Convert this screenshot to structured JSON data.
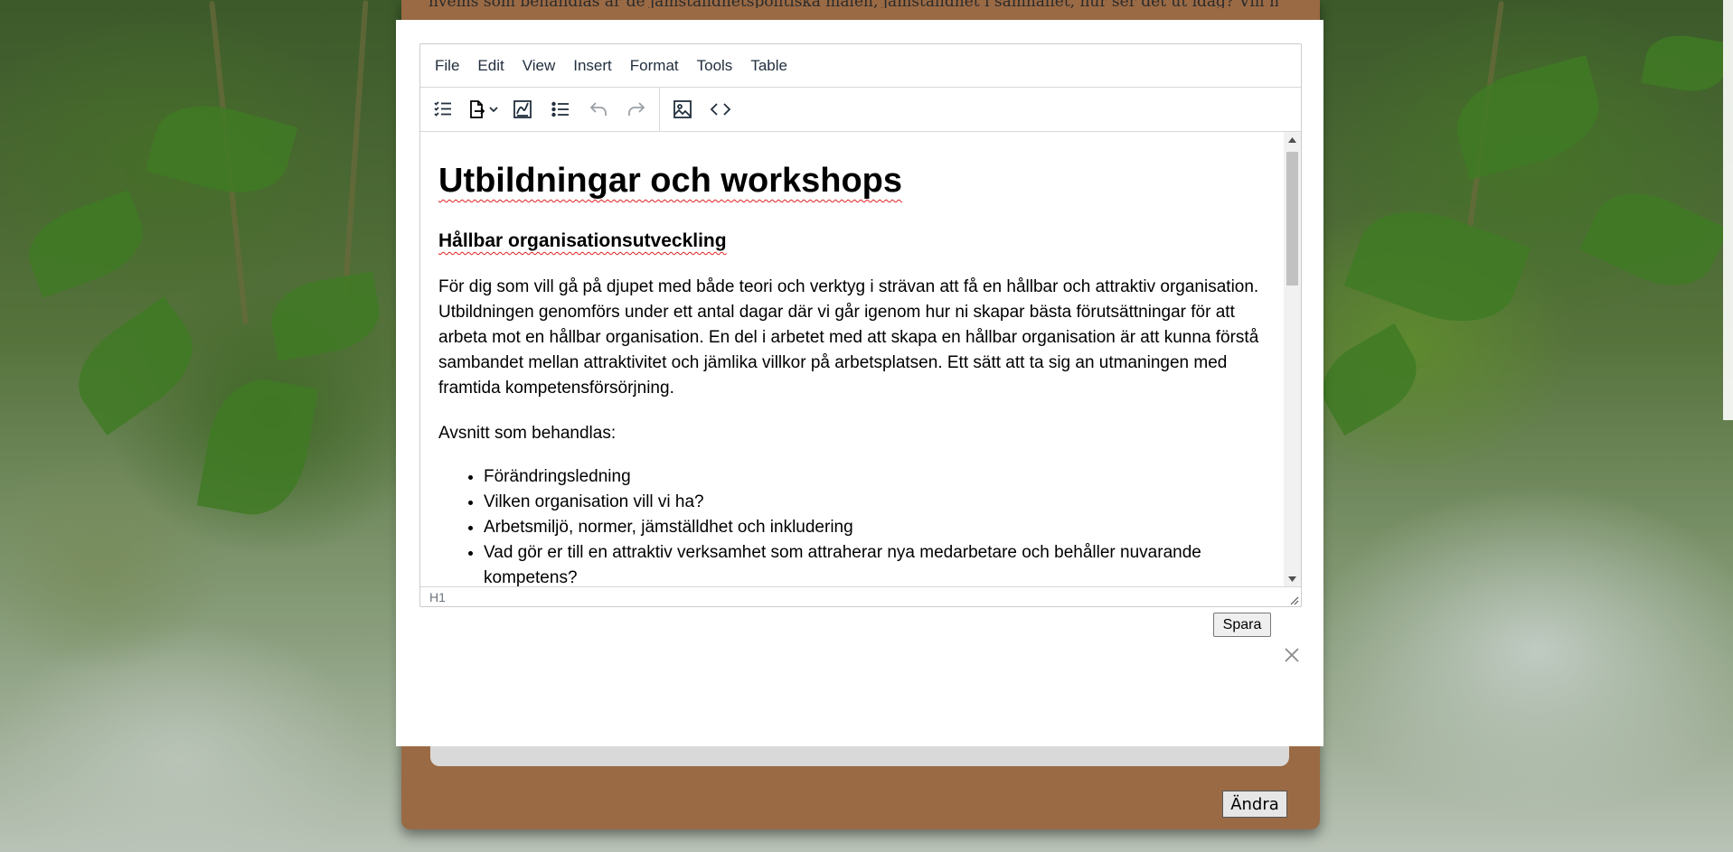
{
  "background": {
    "description": ""
  },
  "card": {
    "top_text": "hvems som behandlas är de jämställdhetspolitiska målen, jämställdhet i samhället, hur ser det ut idag? Vill ni veta mer om det för att få ett förtydligande i jämställdhet handlar om? Utbildningen går igenom",
    "andra_label": "Ändra"
  },
  "editor": {
    "menubar": [
      "File",
      "Edit",
      "View",
      "Insert",
      "Format",
      "Tools",
      "Table"
    ],
    "toolbar": {
      "icons": [
        "checklist-icon",
        "export-icon",
        "chevron-down-icon",
        "signature-icon",
        "bullet-list-icon",
        "undo-icon",
        "redo-icon",
        "image-icon",
        "code-icon"
      ]
    },
    "content": {
      "h1": "Utbildningar och workshops",
      "h2": "Hållbar organisationsutveckling",
      "paragraph1": "För dig som vill gå på djupet med både teori och verktyg i strävan att få en hållbar och attraktiv organisation. Utbildningen genomförs under ett antal dagar där vi går igenom hur ni skapar bästa förutsättningar för att arbeta mot en hållbar organisation. En del i arbetet med att skapa en hållbar organisation är att kunna förstå sambandet mellan attraktivitet och jämlika villkor på arbetsplatsen. Ett sätt att ta sig an utmaningen med framtida kompetensförsörjning.",
      "paragraph2": "Avsnitt som behandlas:",
      "list": [
        "Förändringsledning",
        "Vilken organisation vill vi ha?",
        "Arbetsmiljö, normer, jämställdhet och inkludering",
        "Vad gör er till en attraktiv verksamhet som attraherar nya medarbetare och behåller nuvarande kompetens?"
      ]
    },
    "statusbar": {
      "path": "H1"
    }
  },
  "modal": {
    "save_label": "Spara"
  },
  "colors": {
    "card_brown": "#9a6a45",
    "spellcheck_red": "#e02020",
    "toolbar_icon": "#222f3e"
  }
}
